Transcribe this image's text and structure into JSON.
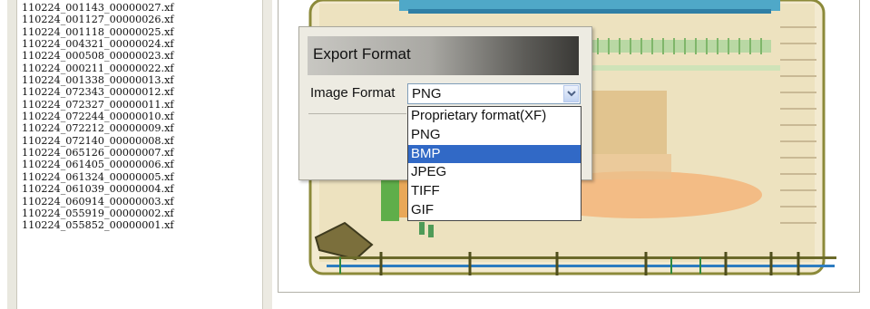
{
  "file_list": {
    "items": [
      "110224_001143_00000027.xf",
      "110224_001127_00000026.xf",
      "110224_001118_00000025.xf",
      "110224_004321_00000024.xf",
      "110224_000508_00000023.xf",
      "110224_000211_00000022.xf",
      "110224_001338_00000013.xf",
      "110224_072343_00000012.xf",
      "110224_072327_00000011.xf",
      "110224_072244_00000010.xf",
      "110224_072212_00000009.xf",
      "110224_072140_00000008.xf",
      "110224_065126_00000007.xf",
      "110224_061405_00000006.xf",
      "110224_061324_00000005.xf",
      "110224_061039_00000004.xf",
      "110224_060914_00000003.xf",
      "110224_055919_00000002.xf",
      "110224_055852_00000001.xf"
    ]
  },
  "export_dialog": {
    "title": "Export Format",
    "image_format_label": "Image Format",
    "selected_value": "PNG",
    "options": [
      "Proprietary format(XF)",
      "PNG",
      "BMP",
      "JPEG",
      "TIFF",
      "GIF"
    ],
    "highlighted_option": "BMP"
  },
  "colors": {
    "highlight": "#3169c6",
    "dialog_bg": "#edebe2"
  }
}
